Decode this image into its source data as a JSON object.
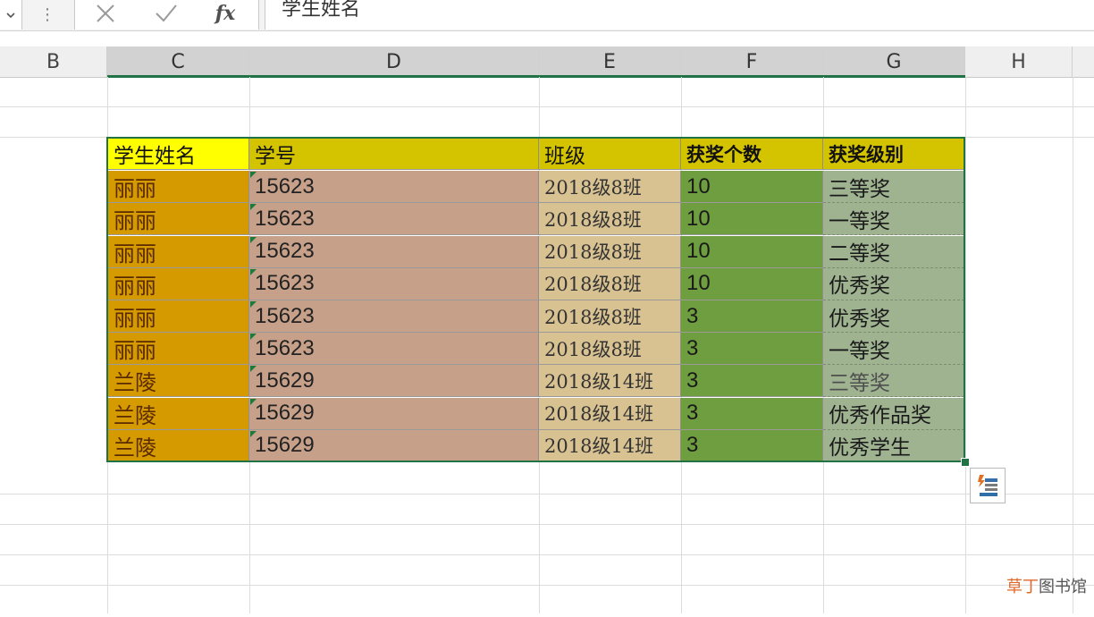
{
  "formula_bar": {
    "cancel_icon": "close-icon",
    "enter_icon": "check-icon",
    "fx_label": "fx",
    "content": "学生姓名"
  },
  "columns": [
    "B",
    "C",
    "D",
    "E",
    "F",
    "G",
    "H"
  ],
  "table": {
    "headers": [
      "学生姓名",
      "学号",
      "班级",
      "获奖个数",
      "获奖级别"
    ],
    "rows": [
      [
        "丽丽",
        "15623",
        "2018级8班",
        "10",
        "三等奖"
      ],
      [
        "丽丽",
        "15623",
        "2018级8班",
        "10",
        "一等奖"
      ],
      [
        "丽丽",
        "15623",
        "2018级8班",
        "10",
        "二等奖"
      ],
      [
        "丽丽",
        "15623",
        "2018级8班",
        "10",
        "优秀奖"
      ],
      [
        "丽丽",
        "15623",
        "2018级8班",
        "3",
        "优秀奖"
      ],
      [
        "丽丽",
        "15623",
        "2018级8班",
        "3",
        "一等奖"
      ],
      [
        "兰陵",
        "15629",
        "2018级14班",
        "3",
        "三等奖"
      ],
      [
        "兰陵",
        "15629",
        "2018级14班",
        "3",
        "优秀作品奖"
      ],
      [
        "兰陵",
        "15629",
        "2018级14班",
        "3",
        "优秀学生"
      ]
    ]
  },
  "colors": {
    "header_name": "#ffff00",
    "header_other": "#d4c400",
    "name_fill": "#d59a00",
    "id_fill": "#c7a08a",
    "class_fill": "#d9c292",
    "count_fill": "#6e9e3f",
    "level_fill": "#9fb391",
    "selection": "#217346"
  },
  "quick_analysis_icon": "quick-analysis-icon",
  "watermark": {
    "part1": "草丁",
    "part2": "图书馆"
  }
}
